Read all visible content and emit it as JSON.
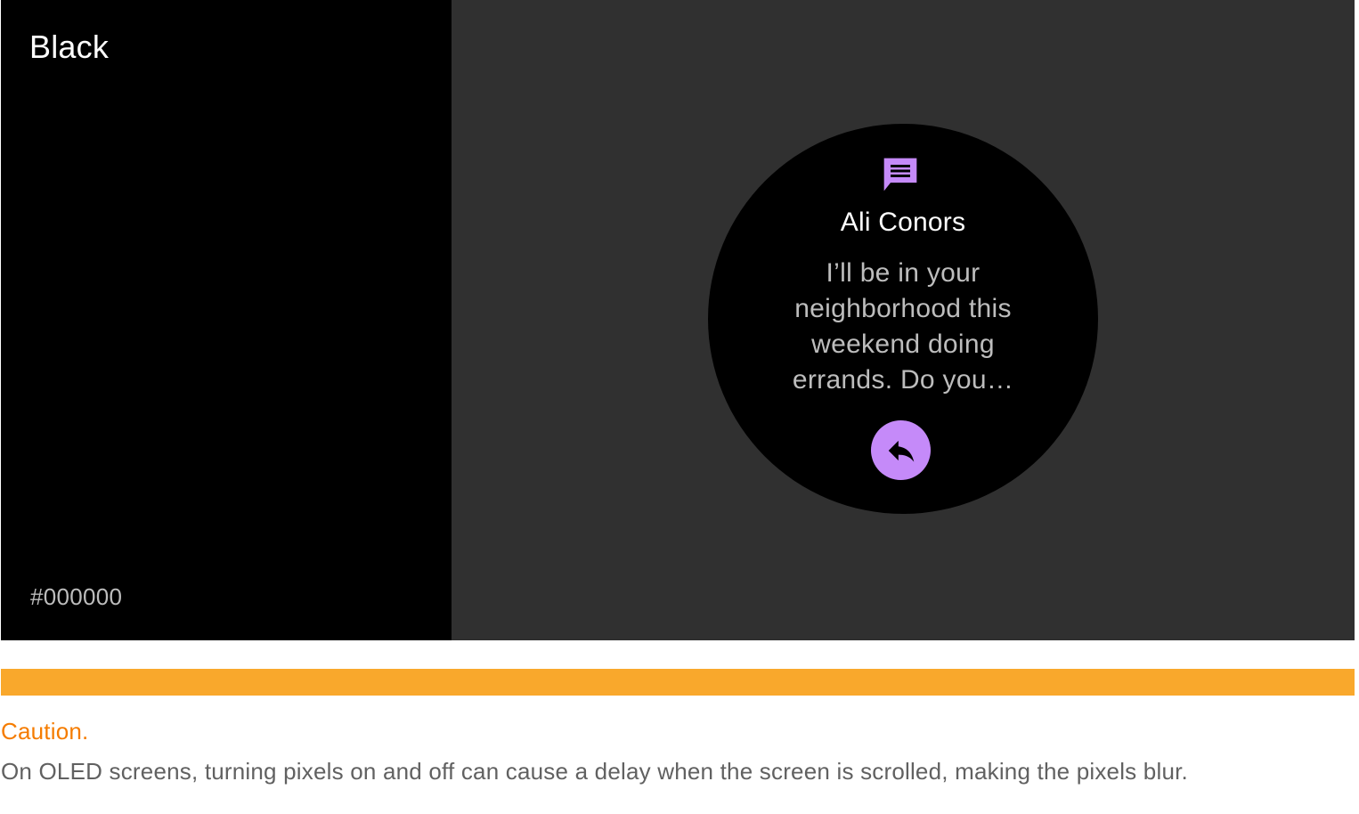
{
  "swatch": {
    "name": "Black",
    "hex": "#000000"
  },
  "watch": {
    "icon": "message-icon",
    "sender": "Ali Conors",
    "message": "I’ll be in your neighborhood this weekend doing errands. Do you…",
    "reply_icon": "reply-icon"
  },
  "caution": {
    "title": "Caution.",
    "body": "On OLED screens, turning pixels on and off can cause a delay when the screen is scrolled, making the pixels blur."
  },
  "colors": {
    "swatch_background": "#000000",
    "preview_background": "#303030",
    "accent": "#c58af9",
    "caution_bar": "#f9a82c",
    "caution_title": "#f57c00",
    "body_text": "#616161"
  }
}
